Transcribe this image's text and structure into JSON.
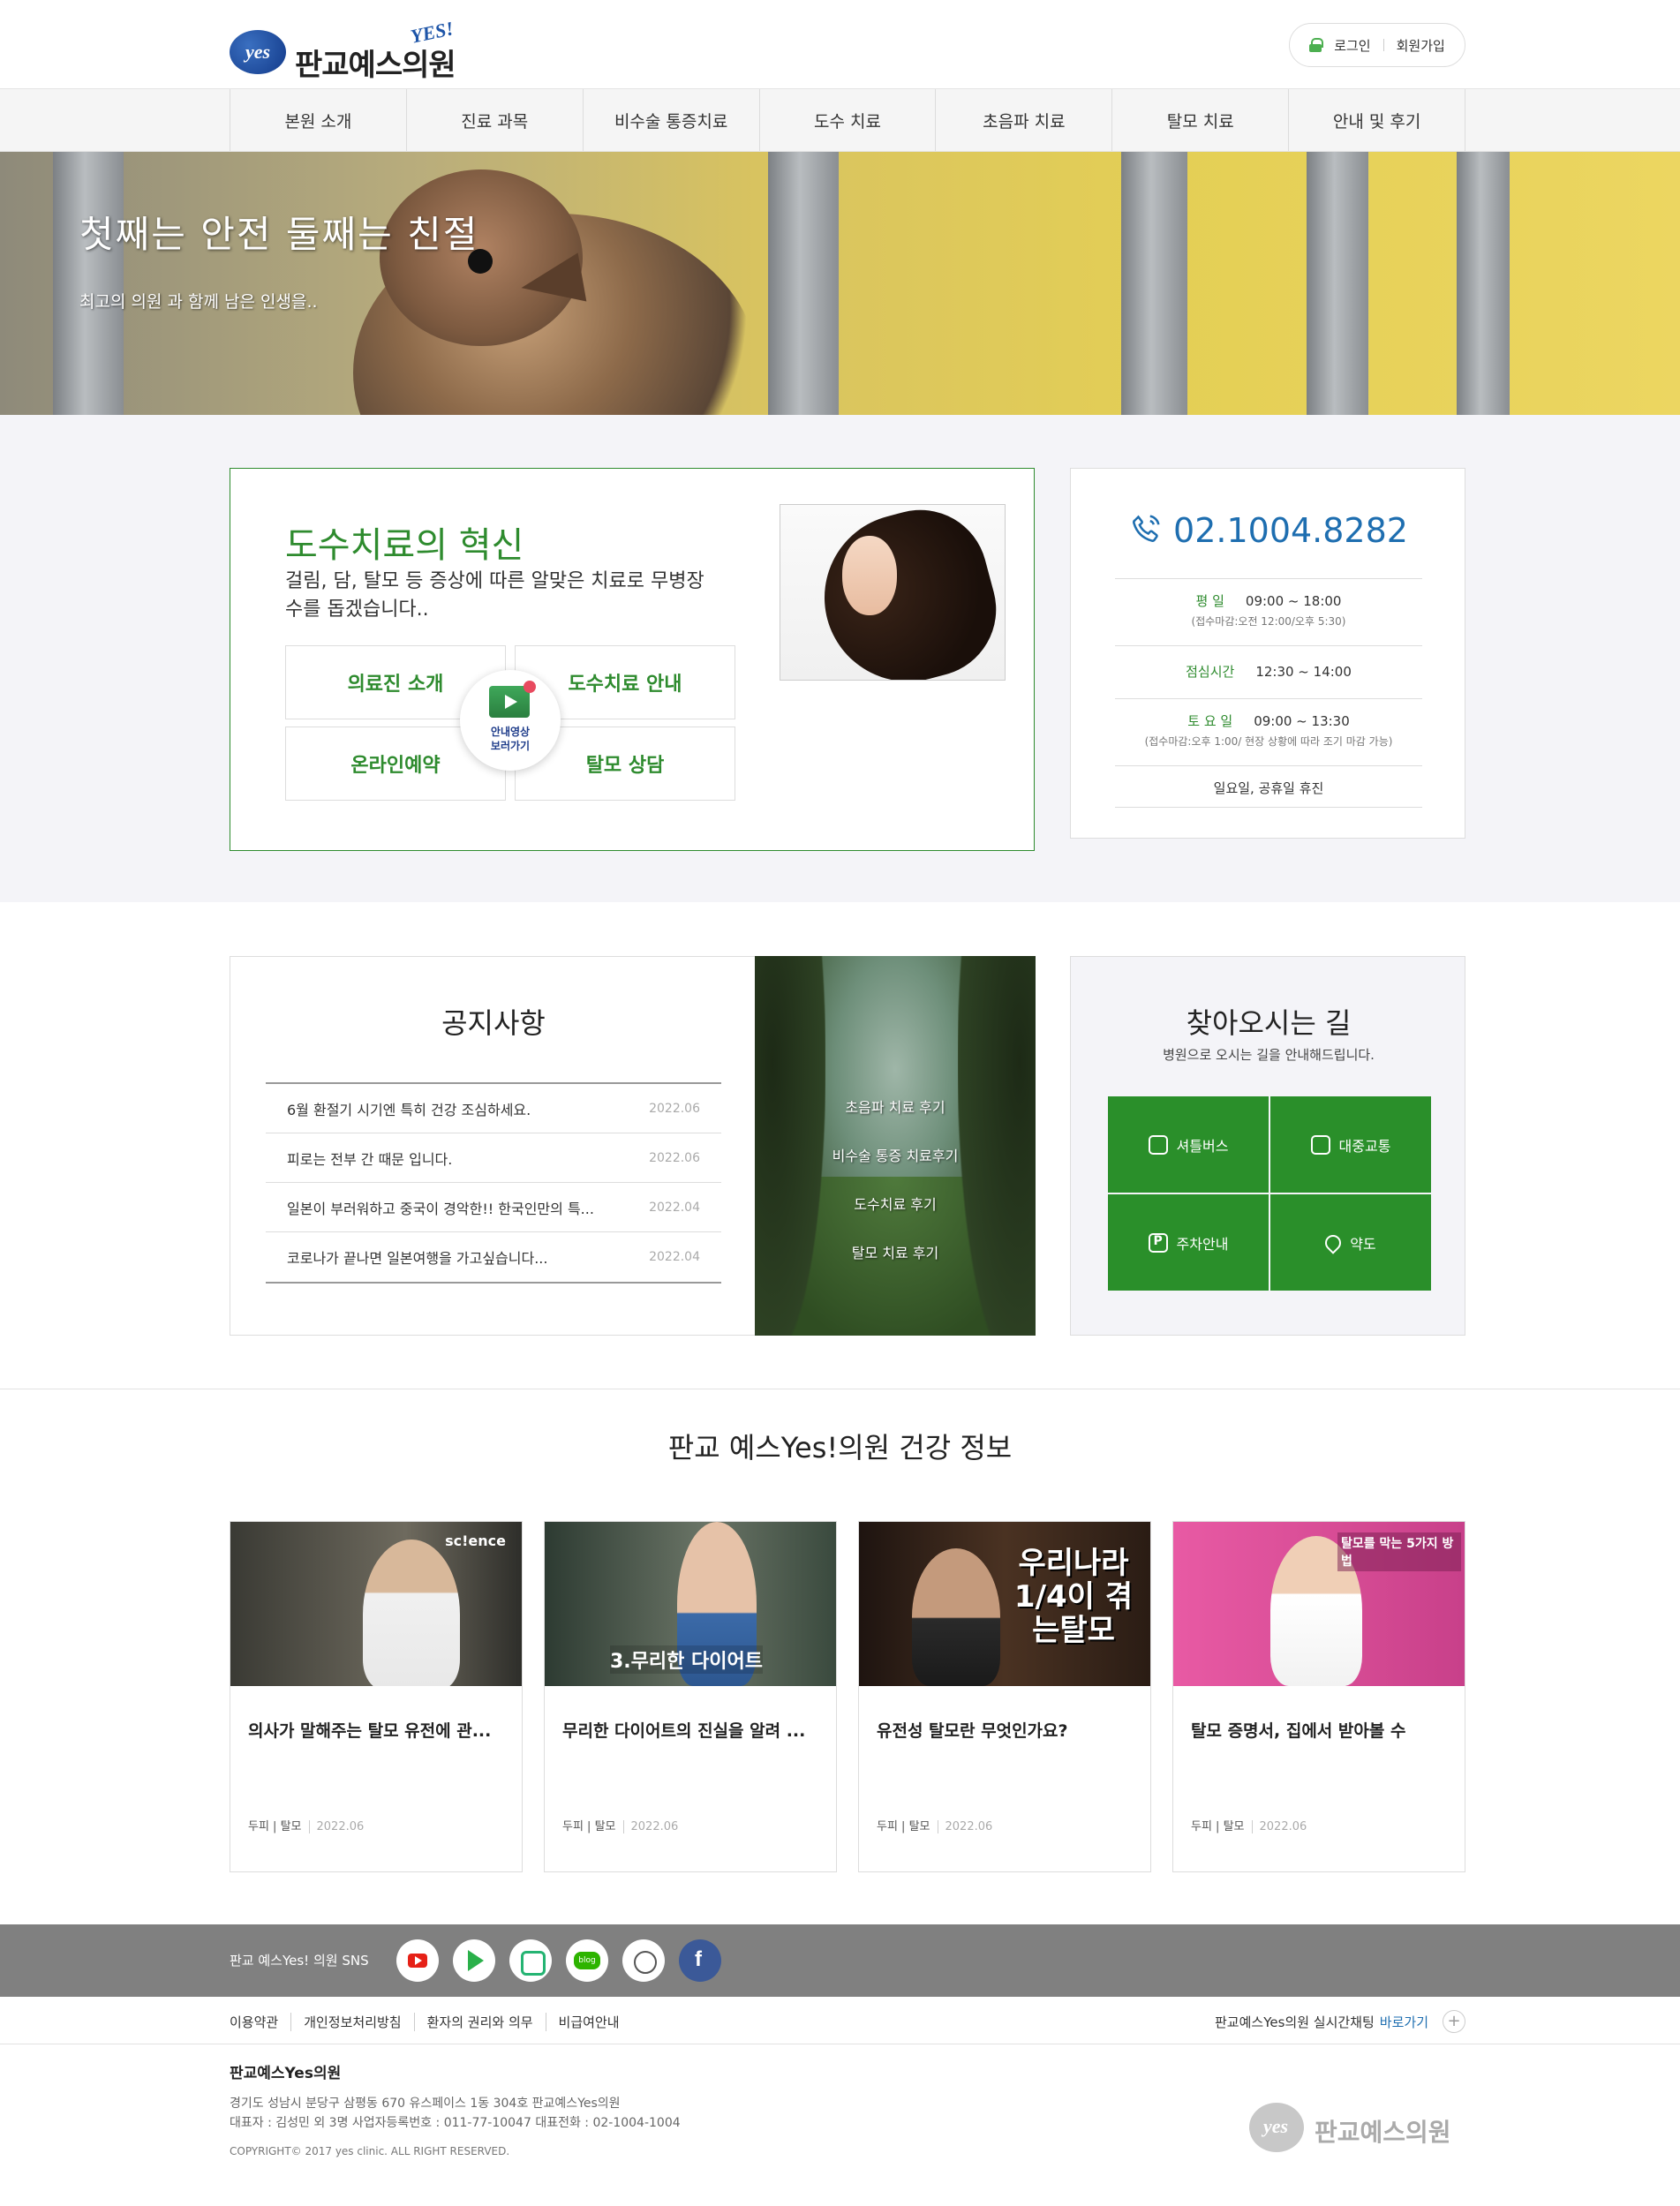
{
  "header": {
    "logo_mark": "yes",
    "logo_name": "판교예스의원",
    "logo_yes": "YES!",
    "login": "로그인",
    "signup": "회원가입"
  },
  "nav": {
    "items": [
      "본원 소개",
      "진료 과목",
      "비수술 통증치료",
      "도수 치료",
      "초음파 치료",
      "탈모 치료",
      "안내 및 후기"
    ]
  },
  "hero": {
    "title": "첫째는 안전 둘째는 친절",
    "subtitle": "최고의 의원 과 함께 남은 인생을.."
  },
  "intro": {
    "heading": "도수치료의 혁신",
    "desc": "걸림, 담, 탈모 등 증상에 따른 알맞은 치료로 무병장수를 돕겠습니다..",
    "buttons": [
      "의료진 소개",
      "도수치료 안내",
      "온라인예약",
      "탈모 상담"
    ],
    "video_label_1": "안내영상",
    "video_label_2": "보러가기"
  },
  "hours": {
    "phone": "02.1004.8282",
    "weekday_label": "평       일",
    "weekday_time": "09:00 ~ 18:00",
    "weekday_note": "(접수마감:오전 12:00/오후 5:30)",
    "lunch_label": "점심시간",
    "lunch_time": "12:30 ~ 14:00",
    "sat_label": "토 요 일",
    "sat_time": "09:00 ~ 13:30",
    "sat_note": "(접수마감:오후 1:00/ 현장 상황에 따라 조기 마감 가능)",
    "closed": "일요일, 공휴일 휴진"
  },
  "notice": {
    "title": "공지사항",
    "items": [
      {
        "title": "6월 환절기 시기엔 특히 건강 조심하세요.",
        "date": "2022.06"
      },
      {
        "title": "피로는 전부 간 때문 입니다.",
        "date": "2022.06"
      },
      {
        "title": "일본이 부러워하고 중국이 경악한!! 한국인만의 특...",
        "date": "2022.04"
      },
      {
        "title": "코로나가 끝나면 일본여행을 가고싶습니다...",
        "date": "2022.04"
      }
    ]
  },
  "reviews": {
    "links": [
      "초음파 치료 후기",
      "비수술 통증 치료후기",
      "도수치료 후기",
      "탈모 치료 후기"
    ]
  },
  "directions": {
    "title": "찾아오시는 길",
    "subtitle": "병원으로 오시는 길을 안내해드립니다.",
    "items": [
      {
        "label": "셔틀버스",
        "icon": "bus-icon"
      },
      {
        "label": "대중교통",
        "icon": "bus-icon"
      },
      {
        "label": "주차안내",
        "icon": "parking-icon"
      },
      {
        "label": "약도",
        "icon": "map-pin-icon"
      }
    ]
  },
  "health": {
    "title": "판교 예스Yes!의원 건강 정보",
    "cards": [
      {
        "title": "의사가 말해주는 탈모 유전에 관...",
        "category": "두피 | 탈모",
        "date": "2022.06",
        "thumb_text": "sc!ence",
        "thumb_bg": "#4a4a44"
      },
      {
        "title": "무리한 다이어트의 진실을 알려 ...",
        "category": "두피 | 탈모",
        "date": "2022.06",
        "thumb_text": "3.무리한 다이어트",
        "thumb_bg": "#3b4a3e"
      },
      {
        "title": "유전성 탈모란 무엇인가요?",
        "category": "두피 | 탈모",
        "date": "2022.06",
        "thumb_text": "우리나라 1/4이 겪는탈모",
        "thumb_bg": "#2a1c14"
      },
      {
        "title": "탈모 증명서, 집에서 받아볼 수",
        "category": "두피 | 탈모",
        "date": "2022.06",
        "thumb_text": "탈모를 막는 5가지 방법",
        "thumb_bg": "#e0509a"
      }
    ]
  },
  "footer": {
    "sns_label": "판교 예스Yes! 의원 SNS",
    "links": [
      "이용약관",
      "개인정보처리방침",
      "환자의 권리와 의무",
      "비급여안내"
    ],
    "chat_label": "판교예스Yes의원 실시간채팅",
    "chat_go": "바로가기",
    "name": "판교예스Yes의원",
    "address": "경기도 성남시 분당구 삼평동 670 유스페이스 1동 304호 판교예스Yes의원",
    "info": "대표자 : 김성민 외 3명    사업자등록번호 : 011-77-10047    대표전화 : 02-1004-1004",
    "copyright": "COPYRIGHT© 2017 yes clinic. ALL RIGHT RESERVED.",
    "logo_mark": "yes",
    "logo_name": "판교예스의원"
  },
  "colors": {
    "accent_green": "#2e8b2e",
    "phone_blue": "#1e6eb0",
    "footer_gray": "#808080"
  }
}
